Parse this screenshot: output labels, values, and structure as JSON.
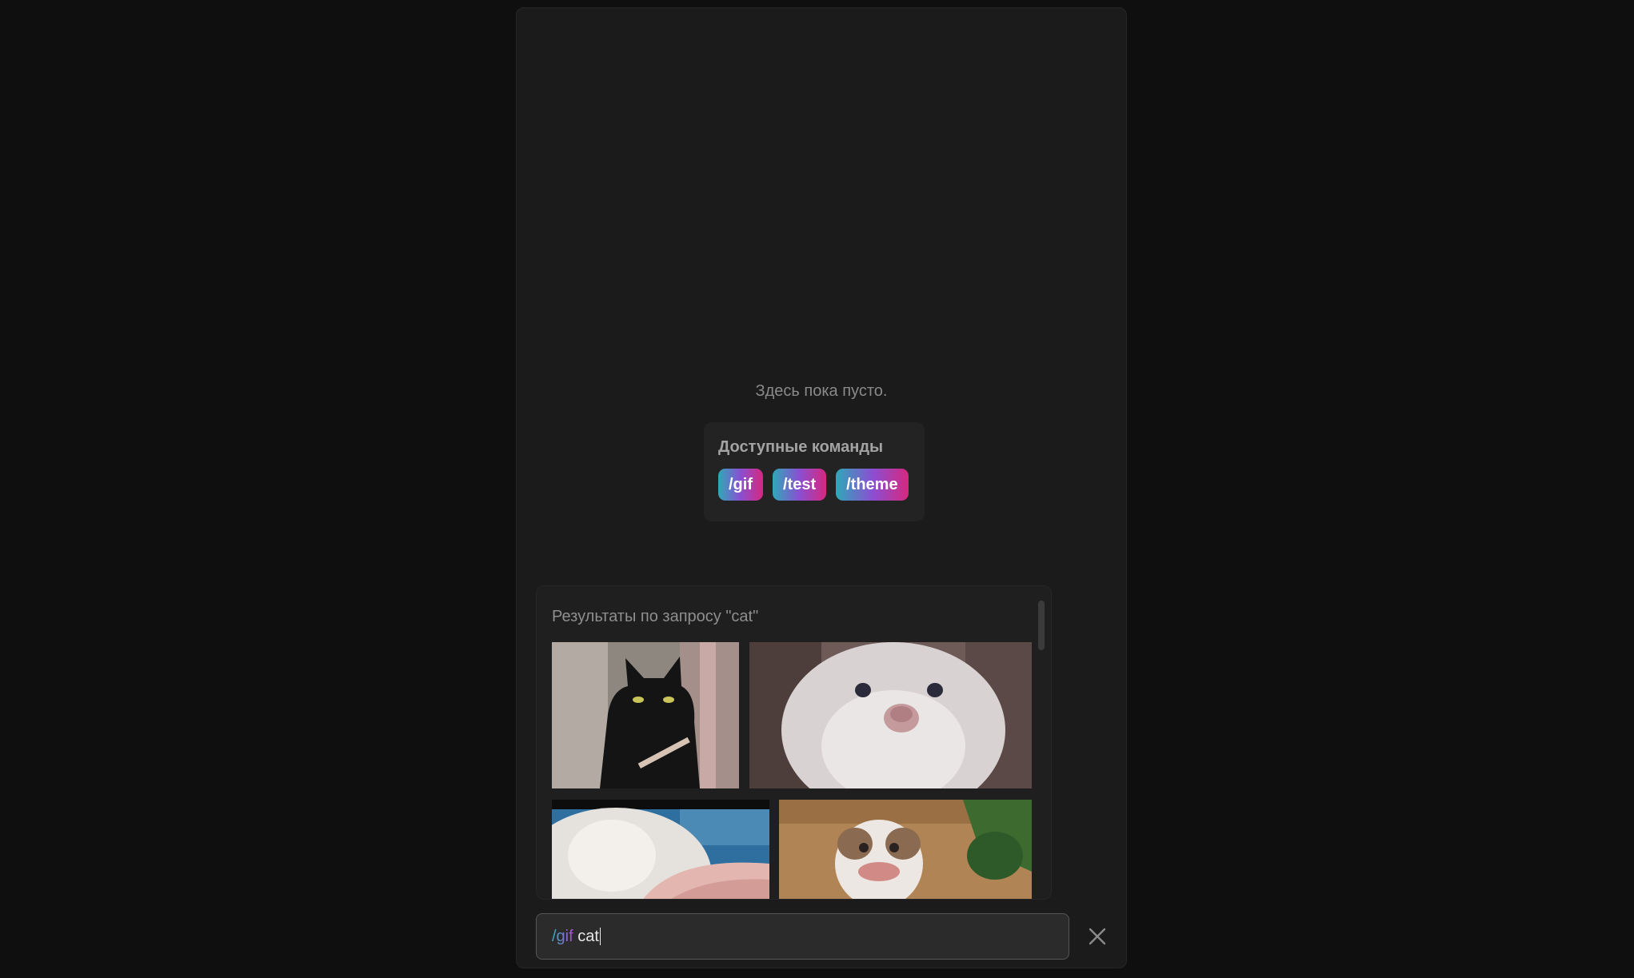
{
  "chat": {
    "empty_text": "Здесь пока пусто."
  },
  "commands": {
    "title": "Доступные команды",
    "items": [
      "/gif",
      "/test",
      "/theme"
    ]
  },
  "gif_panel": {
    "title": "Результаты по запросу \"cat\"",
    "items": [
      "black-cat-gif",
      "white-cat-closeup-gif",
      "white-cat-pet-gif",
      "scottish-fold-cat-gif"
    ]
  },
  "input": {
    "command": "/gif",
    "query": "cat"
  },
  "colors": {
    "background": "#0f0f0f",
    "window": "#1b1b1b",
    "gradient_start": "#2fa9b8",
    "gradient_mid": "#8a4fd2",
    "gradient_end": "#d6287f"
  },
  "icons": {
    "close": "close-icon"
  }
}
